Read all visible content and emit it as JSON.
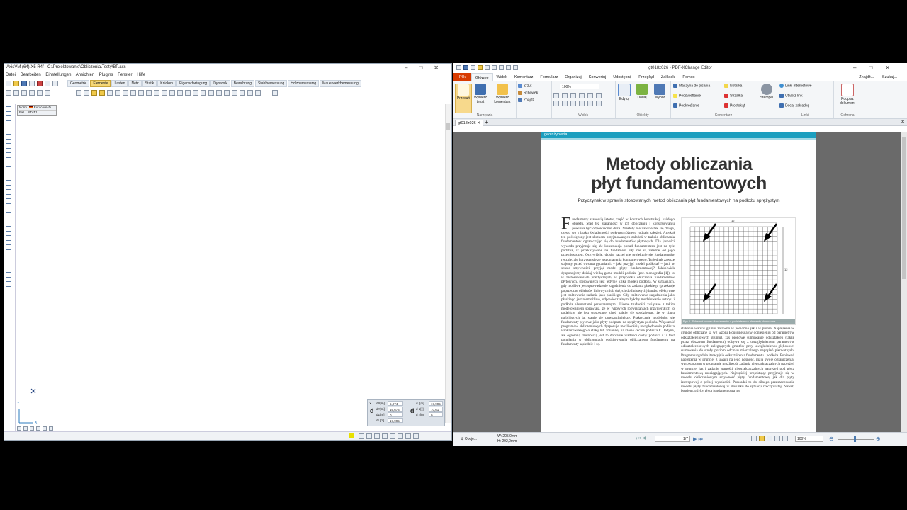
{
  "axis": {
    "title": "AxisVM (64) X5 R4f - C:\\Projektowanie\\Obliczenia\\Testy\\BP.axs",
    "menu": [
      "Datei",
      "Bearbeiten",
      "Einstellungen",
      "Ansichten",
      "Plugins",
      "Fenster",
      "Hilfe"
    ],
    "tabs": [
      "Geometrie",
      "Elemente",
      "Lasten",
      "Netz",
      "Statik",
      "Knicken",
      "Eigenschwingung",
      "Dynamik",
      "Bewehrung",
      "Stahlbemessung",
      "Holzbemessung",
      "Mauerwerkbemessung"
    ],
    "active_tab": "Elemente",
    "info": {
      "norm_label": "Norm",
      "norm_value": "Eurocode-D",
      "fall_label": "Fall",
      "fall_value": "STAT1"
    },
    "coords": {
      "dX_label": "dX[m]",
      "dX": "5,974",
      "dY_label": "dY[m]",
      "dY": "16,674",
      "dZ_label": "dZ[m]",
      "dZ": "0",
      "dL_label": "dL[m]",
      "dL": "17,995",
      "dr_label": "d r[m]",
      "dr": "17,995",
      "da_label": "d α[°]",
      "da": "70,61",
      "dz2_label": "d z[m]",
      "dz2": "0"
    },
    "axis_y": "Y",
    "axis_x": "X"
  },
  "pdf": {
    "title": "gt018z026 - PDF-XChange Editor",
    "tabs": [
      "Plik",
      "Główne",
      "Widok",
      "Komentarz",
      "Formularz",
      "Organizuj",
      "Konwertuj",
      "Udostępnij",
      "Przegląd",
      "Zakładki",
      "Pomoc"
    ],
    "active_tab": "Główne",
    "find": "Znajdź...",
    "search": "Szukaj...",
    "ribbon": {
      "przesun": "Przesuń",
      "wybierz_tekst": "Wybierz tekst",
      "wybierz_komentarz": "Wybierz komentarz",
      "group_narzedzia": "Narzędzia",
      "zrzut": "Zrzut",
      "schowek": "Schowek",
      "znajdz": "Znajdź",
      "zoom": "100%",
      "group_widok": "Widok",
      "edytuj": "Edytuj",
      "dodaj": "Dodaj",
      "wybor": "Wybór",
      "group_obiekty": "Obiekty",
      "maszyna": "Maszyna do pisania",
      "podswietlanie": "Podświetlanie",
      "podkreslanie": "Podkreślanie",
      "notatka": "Notatka",
      "strzalka": "Strzałka",
      "prostokat": "Prostokąt",
      "stempel": "Stempel",
      "group_komentarz": "Komentarz",
      "linki_internetowe": "Linki internetowe",
      "utworz_link": "Utwórz link",
      "dodaj_zakladke": "Dodaj zakładkę",
      "group_linki": "Linki",
      "podpisz": "Podpisz dokument",
      "group_ochrona": "Ochrona"
    },
    "doc_tab": "gt018z026",
    "page": {
      "section": "geoinżynieria",
      "title1": "Metody obliczania",
      "title2": "płyt fundamentowych",
      "subtitle": "Przyczynek w sprawie stosowanych metod obliczania płyt fundamentowych na podłożu sprężystym",
      "dropcap": "F",
      "col1": "undamenty stanowią istotną część w kosztach konstrukcji każdego obiektu. Stąd też staranność w ich obliczaniu i konstruowaniu powinna być odpowiednio duża. Niestety nie zawsze tak się dzieje, często wo z braku świadomości tęgłytwu różnego rodzaju założeń. Artykuł ten poświęcony jest skutkom przyjmowanych założeń w trakcie obliczania fundamentów ograniczając się do fundamentów płytowych. Dla jasności wywodu przyjmuje się, że konstrukcja ponad fundamentem jest na tyle podatna, iż przekazywane na fundament siły nie są zależne od jego przemieszczeń. Oczywiście, dzisiaj raczej nie projektuje się fundamentów ręcznie, ale korzysta się ze wspomagania komputerowego. Tu jednak zawsze stajemy przed dwoma pytaniami: – jaki przyjąć model podłoża? – jaki, w sensie sztywności, przyjąć model płyty fundamentowej? Jakkolwiek dysponujemy dzisiaj wielką gamą modeli podłoża (por. monografia [1]), to w zastosowaniach praktycznych, w przypadku obliczania fundamentów płytowych, stosowanych jest jedynie kilka modeli podłoża. W sytuacjach, gdy możliwe jest sprowadzenie zagadnienia do zadania płaskiego (przekroje poprzeczne obiektów liniowych lub dużych do liniowych) bardzo efektywne jest traktowanie zadania jako płaskiego. Gdy traktowanie zagadnienia jako płaskiego jest niemożliwe, odpowiedzialnym byłoby modelowanie ustroju i podłoża elementami przestrzennymi. Licene trudności związane z takim modelowaniem sprawiają, że w typowych rozwiązaniach inżynierskich to podejście nie jest stosowane, choć należy się spodziewać, że w ciągu najbliższych lat stanie się powszechniejsze. Praktycznie modelując się fundamenty płytowe jako płyty podparte na sprężystym podłożu. Większość programów obliczeniowych dysponuje możliwością uwzględnienia podłoża winklerowskiego o stałej lub zmiennej na rzecie cechie podłoża C. Jedyna, ale ogromną trudnością jest to dobranie wartości cechy podłoża C i fakt pomijania w obliczeniach oddziaływania obliczanego fundamentu na fundamenty sąsiednie i sq.",
      "col2": "stukanie warstw gruntu zarówno w poziomie jak i w pionie. Naprężenia w gruncie obliczane są wg wzoru Boussinesqa (w odniesieniu od parametrów odkształceniowych gruntu), zaś pionowe sumowanie odkształceń (także przez obszarem fundamentu) odbywa się z uwzględnieniem parametrów odkształceniowych zalegających gruntów przy uwzględnieniu głębokości sumowania do strefy poziom odcinku mierzalnego naprężeń pierwotnych. Program uzgadnia iteracyjnie odkształcenia fundamentu i podłoża. Ponieważ naprężenia w gruncie, z uwagi na jego nośność, mają swoje ograniczenia, wprowadzono w programie możliwość zadania nieprzekraczalnych naprężeń w gruncie, jak i zadanie wartości nieprzekraczalnych naprężeń pod płytą fundamentową rozciągających. Najczęściej projektując przyjmuje się w modelu obliczeniowym sztywność płyty fundamentowej jak dla płyty izotropowej o pełnej wysokości. Prowadzi to do silnego przeszacowania modelu płyty fundamentowej w stosunku do sytuacji rzeczywistej. Nawet, bowiem, gdyby płyta fundamentowa nie",
      "fig_caption": "Ryc.1. Schemat modelu fundamentu z podziałem na elementy skończone.",
      "fig_dim_top": "12",
      "fig_dim_right": "12"
    },
    "status": {
      "options": "Opcje...",
      "width": "W: 205,0mm",
      "height": "H: 292,0mm",
      "page": "1/7",
      "zoom": "100%"
    }
  }
}
